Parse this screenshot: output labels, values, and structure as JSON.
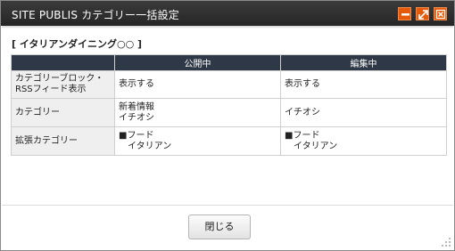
{
  "window": {
    "title": "SITE PUBLIS カテゴリー一括設定",
    "accent_color": "#e65a0b",
    "controls": [
      "minimize-icon",
      "maximize-icon",
      "close-icon"
    ]
  },
  "section_heading": "[ イタリアンダイニング○○ ]",
  "table": {
    "headers": [
      "",
      "公開中",
      "編集中"
    ],
    "rows": [
      {
        "label_line1": "カテゴリーブロック・",
        "label_line2": "RSSフィード表示",
        "published": "表示する",
        "editing": "表示する"
      },
      {
        "label": "カテゴリー",
        "published_line1": "新着情報",
        "published_line2": "イチオシ",
        "editing": "イチオシ"
      },
      {
        "label": "拡張カテゴリー",
        "published_line1": "■フード",
        "published_line2": "イタリアン",
        "editing_line1": "■フード",
        "editing_line2": "イタリアン"
      }
    ]
  },
  "footer": {
    "close_label": "閉じる"
  }
}
